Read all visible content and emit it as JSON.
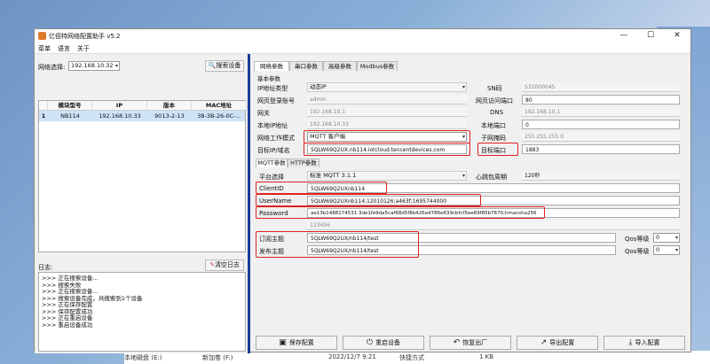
{
  "window": {
    "title": "亿佰特网络配置助手 v5.2",
    "min": "—",
    "max": "☐",
    "close": "✕"
  },
  "menu": [
    "菜单",
    "语言",
    "关于"
  ],
  "left": {
    "net_select_label": "网络选择:",
    "net_select_value": "192.168.10.32",
    "search_btn": "搜索设备",
    "columns": [
      "模块型号",
      "IP",
      "版本",
      "MAC地址"
    ],
    "rows": [
      {
        "idx": "1",
        "model": "NB114",
        "ip": "192.168.10.33",
        "ver": "9013-2-13",
        "mac": "38-3B-26-0C-..."
      }
    ],
    "log_label": "日志:",
    "clear_log_btn": "清空日志",
    "log": [
      ">>> 正在搜索设备...",
      ">>> 搜索失败",
      ">>> 正在搜索设备...",
      ">>> 搜索设备完成，共搜索到1个设备",
      ">>> 正在保存配置",
      ">>> 保存配置成功",
      ">>> 正在重启设备",
      ">>> 重启设备成功"
    ]
  },
  "right": {
    "tabs": [
      "网络参数",
      "串口参数",
      "高级参数",
      "Modbus参数"
    ],
    "basic_label": "基本参数",
    "fields": {
      "ip_type_label": "IP地址类型",
      "ip_type": "动态IP",
      "sn_label": "SN码",
      "sn": "S32000045",
      "web_account_label": "网页登录账号",
      "web_account": "admin",
      "web_port_label": "网页访问端口",
      "web_port": "80",
      "gateway_label": "网关",
      "gateway": "192.168.10.1",
      "dns_label": "DNS",
      "dns": "192.168.10.1",
      "local_ip_label": "本地IP地址",
      "local_ip": "192.168.10.33",
      "local_port_label": "本地端口",
      "local_port": "0",
      "work_mode_label": "网络工作模式",
      "work_mode": "MQTT 客户端",
      "subnet_label": "子网掩码",
      "subnet": "255.255.255.0",
      "target_label": "目标IP/域名",
      "target": "5QLW69Q2UX.nb114.iotcloud.tencentdevices.com",
      "target_port_label": "目标端口",
      "target_port": "1883"
    },
    "subtabs": [
      "MQTT参数",
      "HTTP参数"
    ],
    "mqtt": {
      "platform_label": "平台选择",
      "platform": "标准 MQTT 3.1.1",
      "heartbeat_label": "心跳包周期",
      "heartbeat": "120秒",
      "client_id_label": "ClientID",
      "client_id": "5QLW69Q2UXnb114",
      "username_label": "UserName",
      "username": "5QLW69Q2UXnb114;12010126;a463f;1695744000",
      "password_label": "Password",
      "password": "ae13b1488174531 3de1fe9da5caf68d5f8b426a4786e639cbfcf5ee69f85b7670;hmacsha256",
      "extra": "123456",
      "sub_label": "订阅主题",
      "sub": "5QLW69Q2UX/nb114/test",
      "pub_label": "发布主题",
      "pub": "5QLW69Q2UX/nb114/test",
      "qos_label": "Qos等级",
      "qos1": "0",
      "qos2": "0"
    },
    "buttons": [
      "保存配置",
      "重启设备",
      "恢复出厂",
      "导出配置",
      "导入配置"
    ]
  },
  "taskbar_row": {
    "name": "本地磁盘 (E:)",
    "item": "新加卷 (F:)",
    "date": "2022/12/7 9:21",
    "type": "快捷方式",
    "size": "1 KB"
  },
  "colors": {
    "highlight": "#e02020",
    "divider": "#1a3a9a",
    "selected_row": "#cfe3f7"
  }
}
